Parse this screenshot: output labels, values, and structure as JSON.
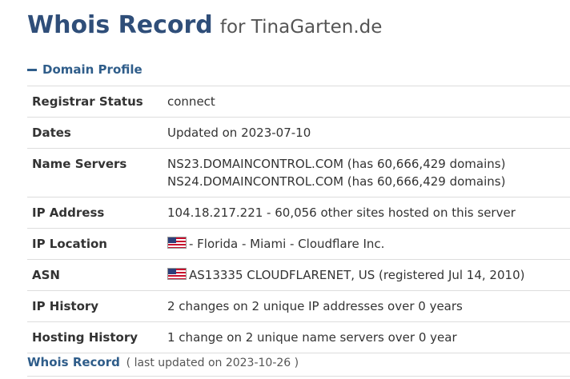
{
  "header": {
    "title": "Whois Record",
    "subtitle": "for TinaGarten.de"
  },
  "domain_profile": {
    "header": "Domain Profile",
    "rows": [
      {
        "label": "Registrar Status",
        "lines": [
          "connect"
        ]
      },
      {
        "label": "Dates",
        "lines": [
          "Updated on 2023-07-10"
        ]
      },
      {
        "label": "Name Servers",
        "lines": [
          "NS23.DOMAINCONTROL.COM (has 60,666,429 domains)",
          "NS24.DOMAINCONTROL.COM (has 60,666,429 domains)"
        ]
      },
      {
        "label": "IP Address",
        "lines": [
          "104.18.217.221 - 60,056 other sites hosted on this server"
        ]
      },
      {
        "label": "IP Location",
        "lines": [
          "- Florida - Miami - Cloudflare Inc."
        ],
        "flag": "us-flag-icon"
      },
      {
        "label": "ASN",
        "lines": [
          "AS13335 CLOUDFLARENET, US (registered Jul 14, 2010)"
        ],
        "flag": "us-flag-icon"
      },
      {
        "label": "IP History",
        "lines": [
          "2 changes on 2 unique IP addresses over 0 years"
        ]
      },
      {
        "label": "Hosting History",
        "lines": [
          "1 change on 2 unique name servers over 0 year"
        ]
      }
    ]
  },
  "whois_record": {
    "link": "Whois Record",
    "meta": "( last updated on 2023-10-26 )"
  }
}
